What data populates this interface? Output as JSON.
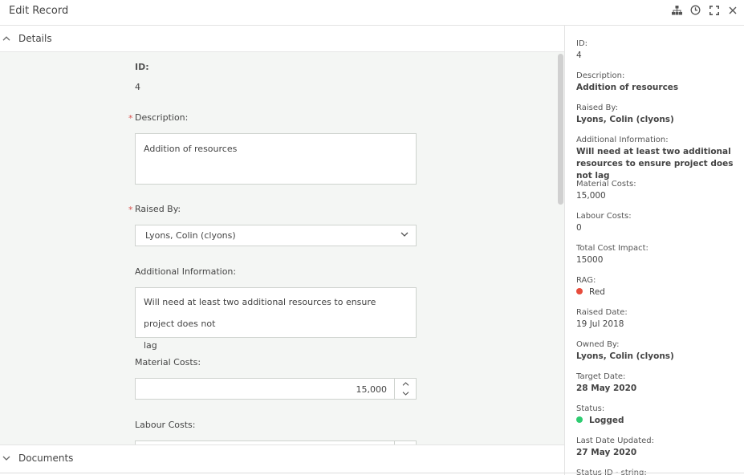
{
  "window": {
    "title": "Edit Record"
  },
  "sections": {
    "details": "Details",
    "documents": "Documents"
  },
  "form": {
    "id_label": "ID:",
    "id_value": "4",
    "description_label": "Description:",
    "description_value": "Addition of resources",
    "raised_by_label": "Raised By:",
    "raised_by_value": "Lyons, Colin (clyons)",
    "additional_info_label": "Additional Information:",
    "additional_info_line1": "Will need at least two additional resources to ensure project does not",
    "additional_info_line2": "lag",
    "material_costs_label": "Material Costs:",
    "material_costs_value": "15,000",
    "labour_costs_label": "Labour Costs:",
    "required_marker": "*"
  },
  "summary": {
    "id": {
      "label": "ID:",
      "value": "4"
    },
    "description": {
      "label": "Description:",
      "value": "Addition of resources"
    },
    "raised_by": {
      "label": "Raised By:",
      "value": "Lyons, Colin (clyons)"
    },
    "additional_info": {
      "label": "Additional Information:",
      "value": "Will need at least two additional resources to ensure project does not lag"
    },
    "material_costs": {
      "label": "Material Costs:",
      "value": "15,000"
    },
    "labour_costs": {
      "label": "Labour Costs:",
      "value": "0"
    },
    "total_cost_impact": {
      "label": "Total Cost Impact:",
      "value": "15000"
    },
    "rag": {
      "label": "RAG:",
      "value": "Red",
      "color": "#e74c3c"
    },
    "raised_date": {
      "label": "Raised Date:",
      "value": "19 Jul 2018"
    },
    "owned_by": {
      "label": "Owned By:",
      "value": "Lyons, Colin (clyons)"
    },
    "target_date": {
      "label": "Target Date:",
      "value": "28 May 2020"
    },
    "status": {
      "label": "Status:",
      "value": "Logged",
      "color": "#2ecc71"
    },
    "last_date_updated": {
      "label": "Last Date Updated:",
      "value": "27 May 2020"
    },
    "status_id": {
      "label": "Status ID - string:"
    }
  },
  "icons": {
    "hierarchy": "hierarchy-icon",
    "history": "history-icon",
    "fullscreen": "fullscreen-icon",
    "close": "close-icon"
  }
}
